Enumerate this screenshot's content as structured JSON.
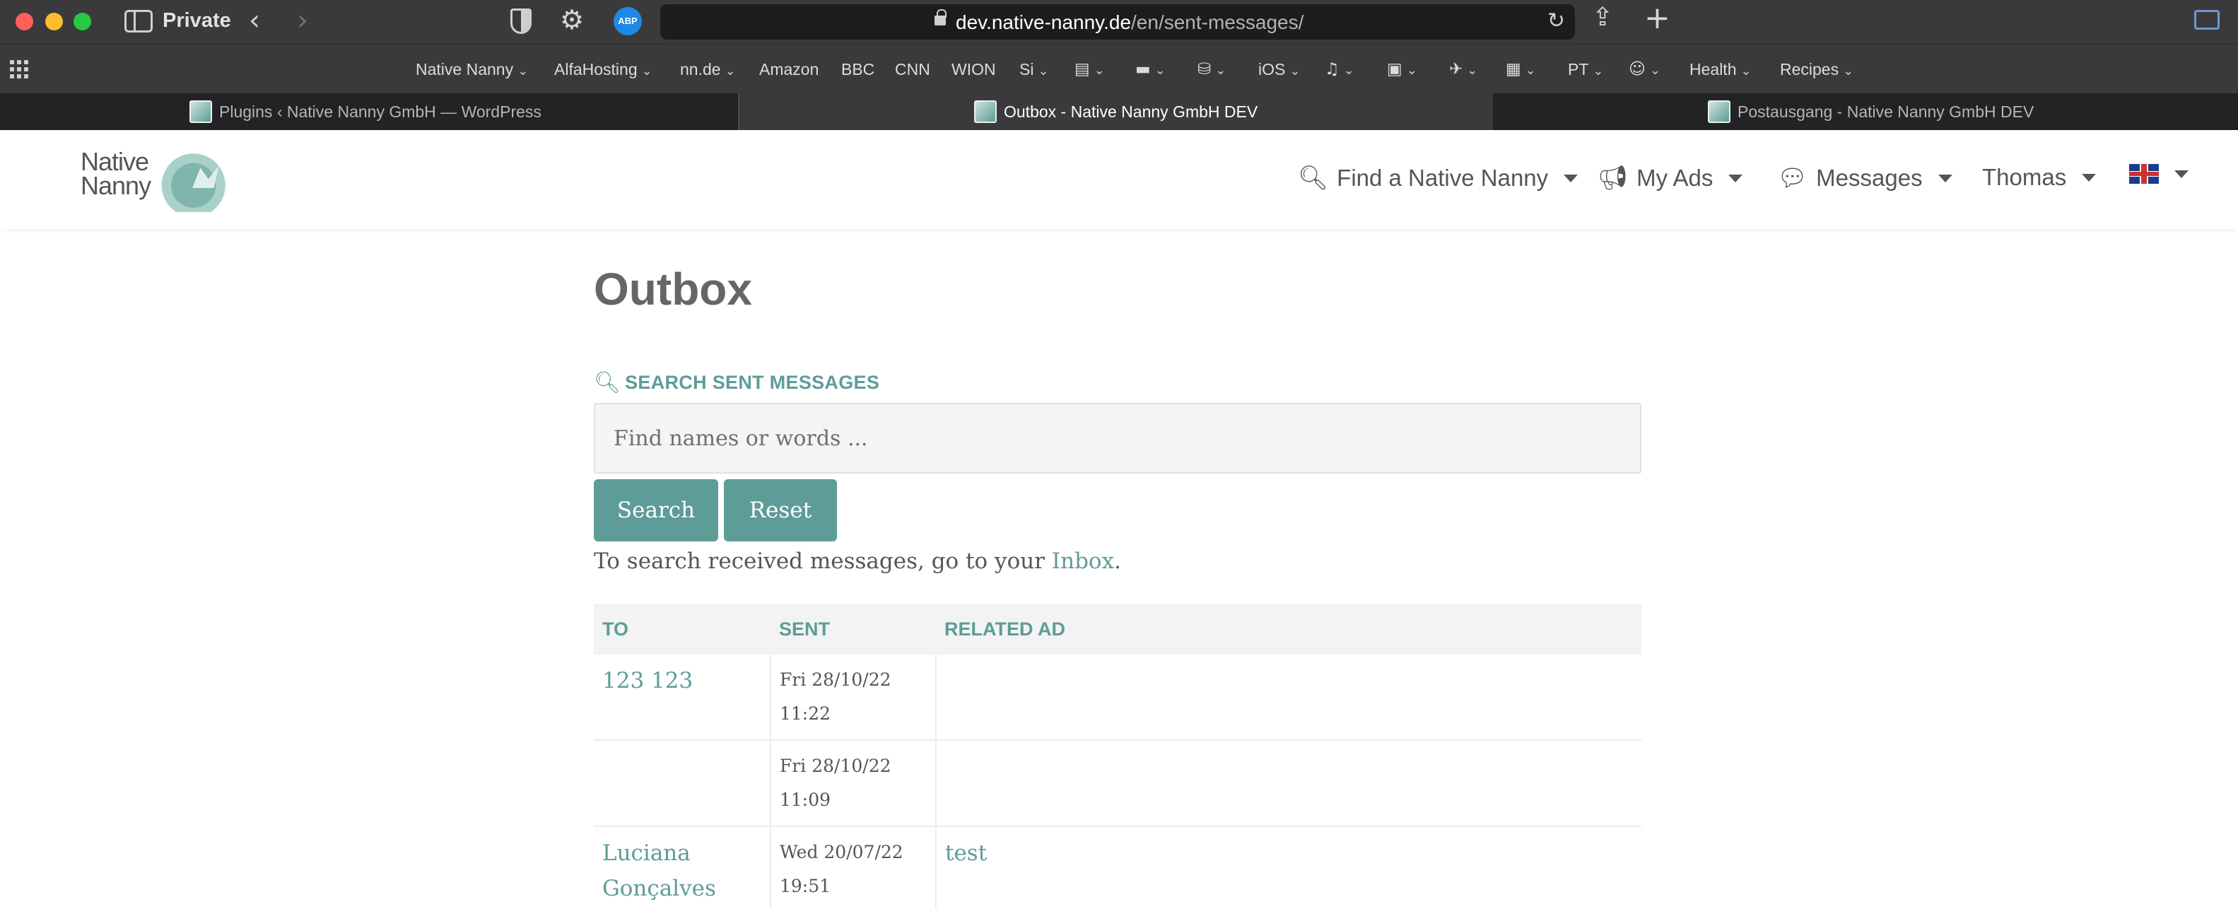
{
  "browser": {
    "window_mode": "Private",
    "url_domain": "dev.native-nanny.de",
    "url_path": "/en/sent-messages/",
    "abp_label": "ABP",
    "bookmarks": [
      {
        "label": "Native Nanny",
        "chevron": true
      },
      {
        "label": "AlfaHosting",
        "chevron": true
      },
      {
        "label": "nn.de",
        "chevron": true
      },
      {
        "label": "Amazon",
        "chevron": false
      },
      {
        "label": "BBC",
        "chevron": false
      },
      {
        "label": "CNN",
        "chevron": false
      },
      {
        "label": "WION",
        "chevron": false
      },
      {
        "label": "Si",
        "chevron": true
      },
      {
        "label": "PT",
        "chevron": true
      },
      {
        "label": "Health",
        "chevron": true
      },
      {
        "label": "Recipes",
        "chevron": true
      }
    ],
    "tabs": [
      {
        "title": "Plugins ‹ Native Nanny GmbH — WordPress",
        "active": false
      },
      {
        "title": "Outbox - Native Nanny GmbH DEV",
        "active": true
      },
      {
        "title": "Postausgang - Native Nanny GmbH DEV",
        "active": false
      }
    ]
  },
  "site": {
    "logo_text_line1": "Native",
    "logo_text_line2": "Nanny",
    "nav": {
      "find": "Find a Native Nanny",
      "ads": "My Ads",
      "messages": "Messages",
      "user": "Thomas"
    }
  },
  "page": {
    "title": "Outbox",
    "search_heading": "SEARCH SENT MESSAGES",
    "search_placeholder": "Find names or words ...",
    "search_button": "Search",
    "reset_button": "Reset",
    "help_prefix": "To search received messages, go to your ",
    "help_link": "Inbox",
    "help_suffix": "."
  },
  "table": {
    "headers": {
      "to": "TO",
      "sent": "SENT",
      "related_ad": "RELATED AD"
    },
    "rows": [
      {
        "to": "123 123",
        "sent_date": "Fri 28/10/22",
        "sent_time": "11:22",
        "related_ad": ""
      },
      {
        "to": "",
        "sent_date": "Fri 28/10/22",
        "sent_time": "11:09",
        "related_ad": ""
      },
      {
        "to_line1": "Luciana",
        "to_line2": "Gonçalves",
        "sent_date": "Wed 20/07/22",
        "sent_time": "19:51",
        "related_ad": "test"
      }
    ]
  },
  "colors": {
    "accent": "#5e9c97",
    "text": "#555555",
    "chrome": "#3a3a3c"
  },
  "icons": [
    "sidebar-icon",
    "back-chevron-icon",
    "forward-chevron-icon",
    "shield-icon",
    "gear-icon",
    "abp-icon",
    "lock-icon",
    "reload-icon",
    "share-icon",
    "new-tab-plus-icon",
    "search-icon",
    "megaphone-icon",
    "chat-icon",
    "caret-down-icon",
    "uk-flag-icon"
  ]
}
